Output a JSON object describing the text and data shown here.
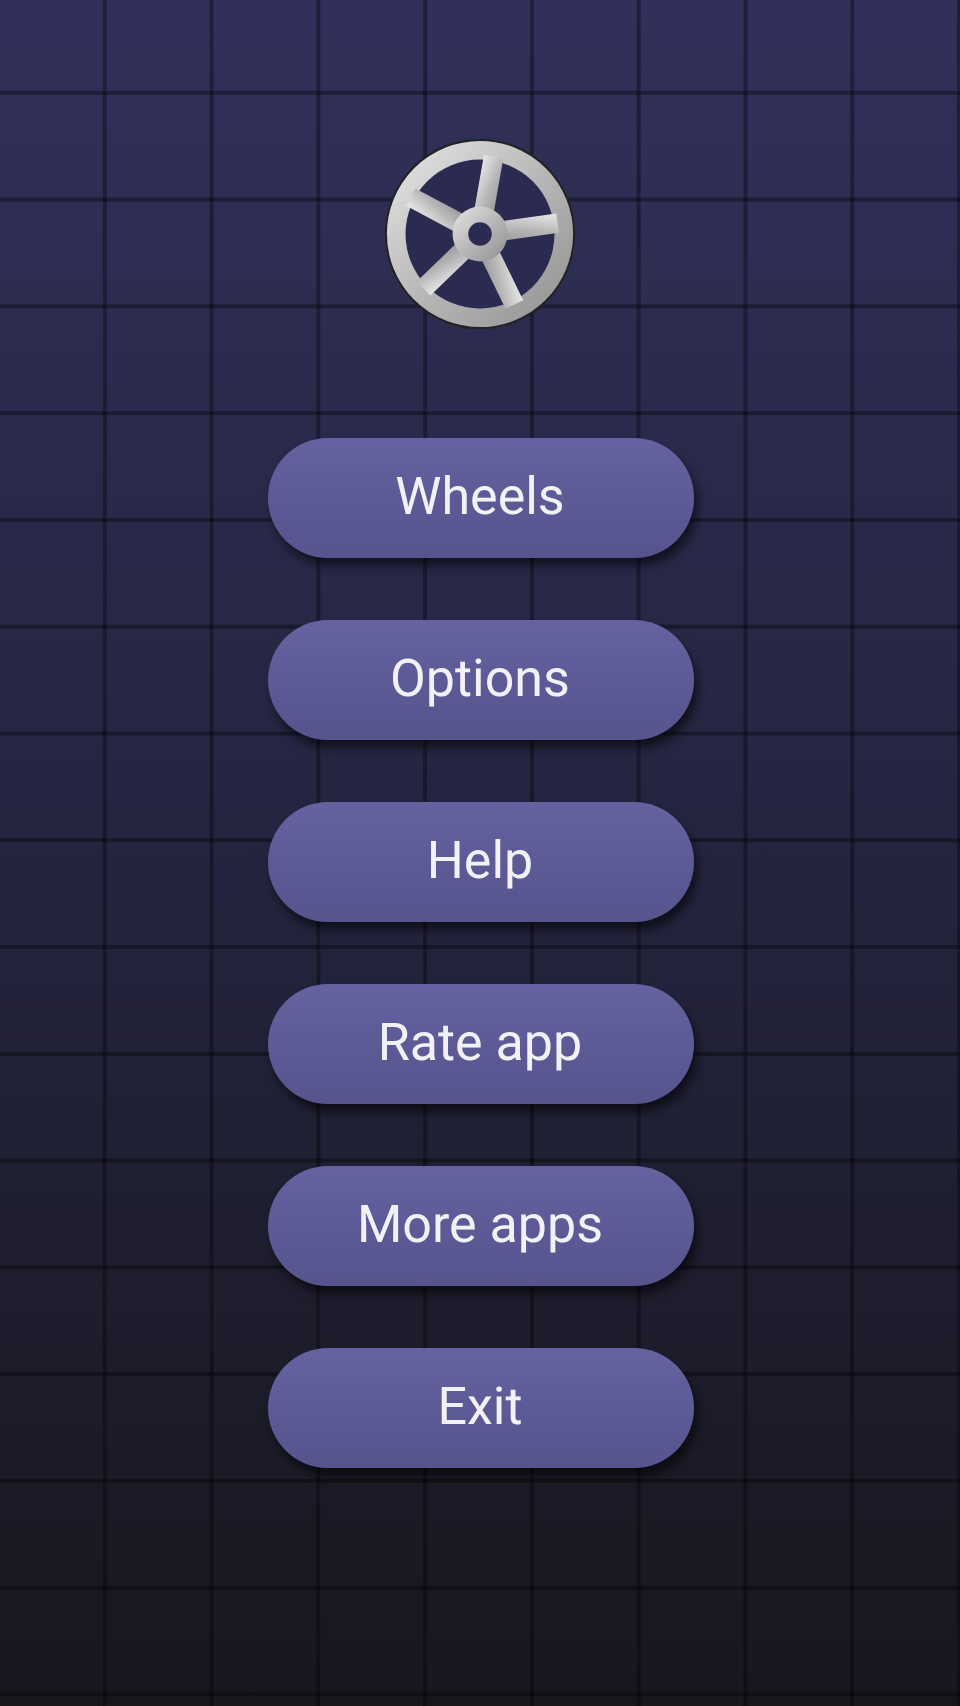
{
  "menu": [
    {
      "label": "Wheels"
    },
    {
      "label": "Options"
    },
    {
      "label": "Help"
    },
    {
      "label": "Rate app"
    },
    {
      "label": "More apps"
    },
    {
      "label": "Exit"
    }
  ]
}
